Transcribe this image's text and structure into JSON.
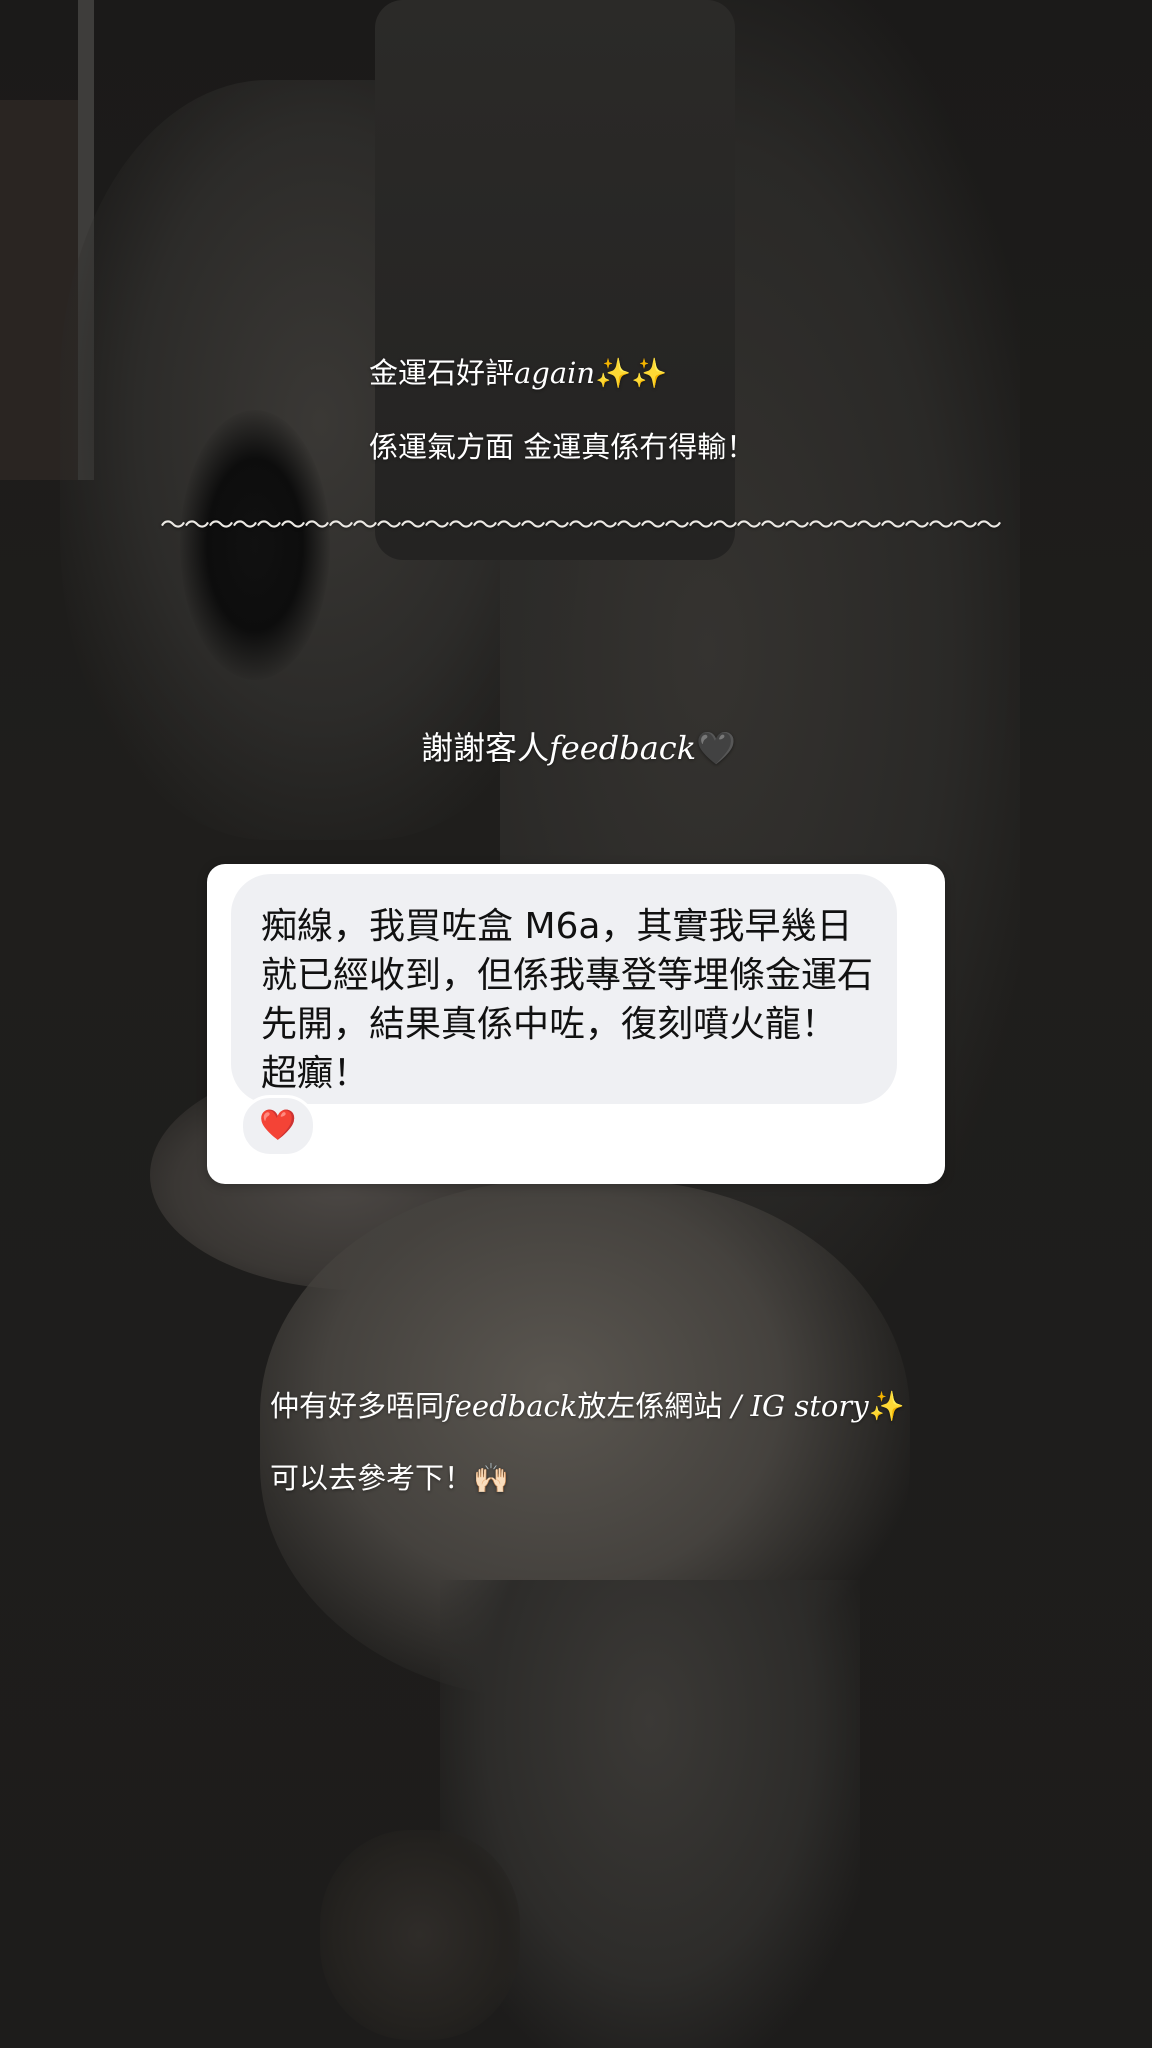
{
  "story": {
    "line1": {
      "text": "金運石好評",
      "italic": "again",
      "emoji": "✨✨"
    },
    "line2": "係運氣方面 金運真係冇得輸！",
    "divider": "〜〜〜〜〜〜〜〜〜〜〜〜〜〜〜〜〜〜〜〜〜〜〜〜〜〜〜〜〜〜〜〜〜〜〜",
    "thanks": {
      "text": "謝謝客人",
      "italic": "feedback",
      "emoji": "🖤"
    },
    "more": {
      "text_a": "仲有好多唔同",
      "italic_a": "feedback",
      "text_b": "放左係網站",
      "italic_b": " / IG story",
      "emoji": "✨"
    },
    "reference": {
      "text": "可以去參考下！",
      "emoji": "🙌🏻"
    }
  },
  "message_card": {
    "text": "痴線，我買咗盒 M6a，其實我早幾日就已經收到，但係我專登等埋條金運石先開，結果真係中咗，復刻噴火龍！ 超癲！",
    "reaction_icon": "heart-reaction",
    "reaction": "❤️"
  },
  "colors": {
    "background": "#1d1c1b",
    "card": "#ffffff",
    "bubble": "#eff0f3",
    "heart": "#e0243a"
  }
}
